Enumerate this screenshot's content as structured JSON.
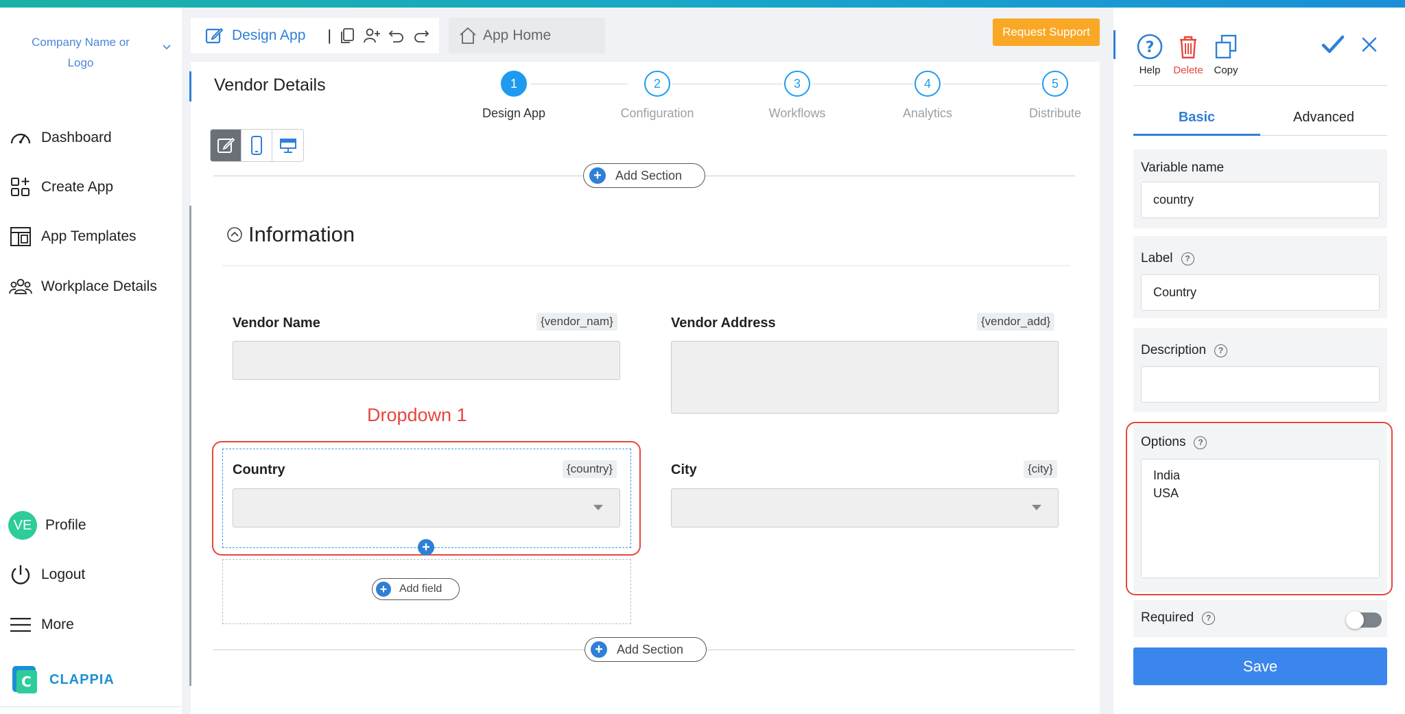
{
  "sidebar": {
    "company": "Company Name or Logo",
    "items": [
      {
        "label": "Dashboard",
        "icon": "gauge-icon"
      },
      {
        "label": "Create App",
        "icon": "grid-plus-icon"
      },
      {
        "label": "App Templates",
        "icon": "template-icon"
      },
      {
        "label": "Workplace Details",
        "icon": "users-icon"
      }
    ],
    "bottom": {
      "avatar_initials": "VE",
      "profile": "Profile",
      "logout": "Logout",
      "more": "More"
    },
    "brand": "CLAPPIA"
  },
  "header": {
    "design_tab": "Design App",
    "separator": "|",
    "home_tab": "App Home",
    "request_support": "Request Support"
  },
  "page_title": "Vendor Details",
  "stepper": [
    {
      "num": "1",
      "label": "Design App",
      "active": true
    },
    {
      "num": "2",
      "label": "Configuration",
      "active": false
    },
    {
      "num": "3",
      "label": "Workflows",
      "active": false
    },
    {
      "num": "4",
      "label": "Analytics",
      "active": false
    },
    {
      "num": "5",
      "label": "Distribute",
      "active": false
    }
  ],
  "canvas": {
    "add_section": "Add Section",
    "section_title": "Information",
    "fields": {
      "vendor_name": {
        "label": "Vendor Name",
        "var": "{vendor_nam}"
      },
      "vendor_address": {
        "label": "Vendor Address",
        "var": "{vendor_add}"
      },
      "country": {
        "label": "Country",
        "var": "{country}"
      },
      "city": {
        "label": "City",
        "var": "{city}"
      }
    },
    "annotation": "Dropdown 1",
    "add_field": "Add field"
  },
  "right_panel": {
    "tools": {
      "help": "Help",
      "delete": "Delete",
      "copy": "Copy"
    },
    "tabs": {
      "basic": "Basic",
      "advanced": "Advanced"
    },
    "variable_name": {
      "label": "Variable name",
      "value": "country"
    },
    "label": {
      "label": "Label",
      "value": "Country"
    },
    "description": {
      "label": "Description",
      "value": ""
    },
    "options": {
      "label": "Options",
      "values": [
        "India",
        "USA"
      ]
    },
    "required": {
      "label": "Required",
      "on": false
    },
    "save": "Save"
  },
  "colors": {
    "accent": "#2f7fd6",
    "stepper": "#1e9bf0",
    "request_support": "#f9a825",
    "annotation_red": "#e8453c",
    "delete_red": "#e8453c",
    "avatar": "#2ecc9a",
    "save": "#3b86ec"
  }
}
